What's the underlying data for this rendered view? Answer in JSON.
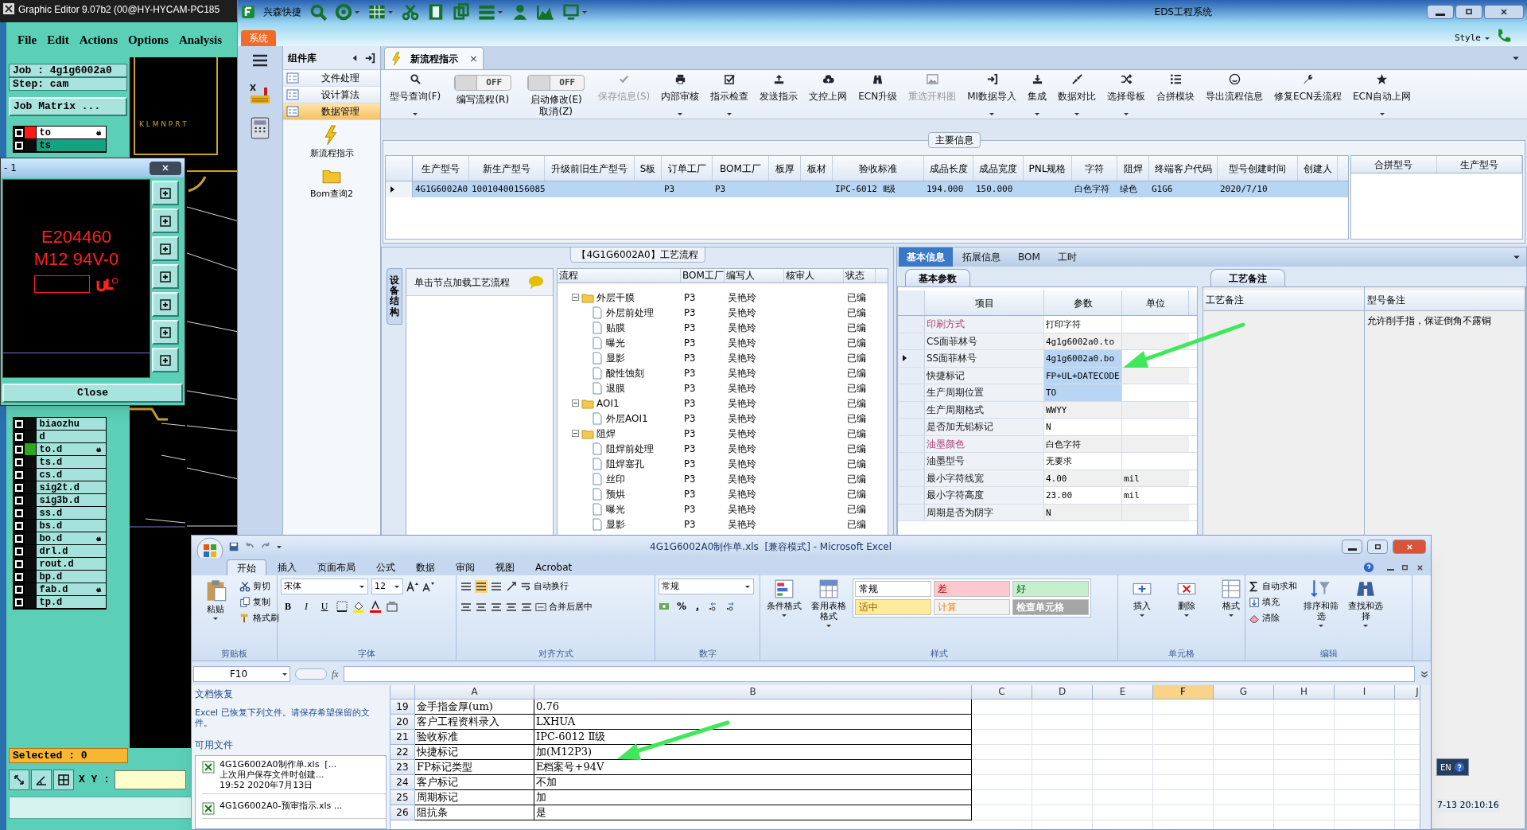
{
  "graphic_editor": {
    "title": "Graphic Editor 9.07b2 (00@HY-HYCAM-PC185",
    "menu": [
      "File",
      "Edit",
      "Actions",
      "Options",
      "Analysis"
    ],
    "job": "Job : 4g1g6002a0",
    "step": "Step: cam",
    "job_matrix": "Job Matrix ...",
    "layers_top": [
      {
        "name": "to",
        "color": "#ffffff",
        "checked": false,
        "work_layer": true,
        "displayed": false,
        "flag": true
      },
      {
        "name": "ts",
        "color": "#13a380",
        "checked": false,
        "work_layer": false,
        "displayed": false,
        "flag": false
      }
    ],
    "layers_bottom": [
      {
        "name": "biaozhu",
        "color": "#a6e2dc",
        "checked": false,
        "work_layer": false,
        "displayed": false,
        "flag": false
      },
      {
        "name": "d",
        "color": "#a6e2dc",
        "checked": false,
        "work_layer": false,
        "displayed": false,
        "flag": false
      },
      {
        "name": "to.d",
        "color": "#a6e2dc",
        "checked": false,
        "work_layer": false,
        "displayed": true,
        "flag": true
      },
      {
        "name": "ts.d",
        "color": "#a6e2dc",
        "checked": false,
        "work_layer": false,
        "displayed": false,
        "flag": false
      },
      {
        "name": "cs.d",
        "color": "#a6e2dc",
        "checked": false,
        "work_layer": false,
        "displayed": false,
        "flag": false
      },
      {
        "name": "sig2t.d",
        "color": "#a6e2dc",
        "checked": false,
        "work_layer": false,
        "displayed": false,
        "flag": false
      },
      {
        "name": "sig3b.d",
        "color": "#a6e2dc",
        "checked": false,
        "work_layer": false,
        "displayed": false,
        "flag": false
      },
      {
        "name": "ss.d",
        "color": "#a6e2dc",
        "checked": false,
        "work_layer": false,
        "displayed": false,
        "flag": false
      },
      {
        "name": "bs.d",
        "color": "#a6e2dc",
        "checked": false,
        "work_layer": false,
        "displayed": false,
        "flag": false
      },
      {
        "name": "bo.d",
        "color": "#a6e2dc",
        "checked": false,
        "work_layer": false,
        "displayed": false,
        "flag": true
      },
      {
        "name": "drl.d",
        "color": "#a6e2dc",
        "checked": false,
        "work_layer": false,
        "displayed": false,
        "flag": false
      },
      {
        "name": "rout.d",
        "color": "#a6e2dc",
        "checked": false,
        "work_layer": false,
        "displayed": false,
        "flag": false
      },
      {
        "name": "bp.d",
        "color": "#a6e2dc",
        "checked": false,
        "work_layer": false,
        "displayed": false,
        "flag": false
      },
      {
        "name": "fab.d",
        "color": "#a6e2dc",
        "checked": false,
        "work_layer": false,
        "displayed": false,
        "flag": true
      },
      {
        "name": "tp.d",
        "color": "#a6e2dc",
        "checked": false,
        "work_layer": false,
        "displayed": false,
        "flag": false
      }
    ],
    "canvas_label": "K L M N P R T",
    "selected": "Selected : 0",
    "xy_label": "X Y :"
  },
  "layer_dialog": {
    "title": "- 1",
    "lines": [
      "E204460",
      "M12 94V-0"
    ],
    "close": "Close"
  },
  "eds": {
    "title": "EDS工程系统",
    "quick_access": "兴森快捷",
    "ribbon_tabs": [
      {
        "label": "系统",
        "selected": true
      }
    ],
    "style_menu": "Style",
    "component_panel": {
      "title": "组件库",
      "items": [
        {
          "label": "文件处理",
          "selected": false
        },
        {
          "label": "设计算法",
          "selected": false
        },
        {
          "label": "数据管理",
          "selected": true
        }
      ],
      "shortcuts": [
        {
          "label": "新流程指示",
          "kind": "lightning"
        },
        {
          "label": "Bom查询2",
          "kind": "folder"
        }
      ]
    },
    "doc_tab": {
      "label": "新流程指示",
      "close": "×"
    },
    "toolbar": [
      {
        "kind": "button",
        "label": "型号查询(F)",
        "disabled": false,
        "dropdown": true
      },
      {
        "kind": "toggle",
        "label": "编写流程(R)",
        "state_text": "OFF",
        "on": false
      },
      {
        "kind": "toggle",
        "label": "启动修改(E)",
        "sub_label": "取消(Z)",
        "state_text": "OFF",
        "on": false
      },
      {
        "kind": "button",
        "label": "保存信息(S)",
        "disabled": true,
        "dropdown": false
      },
      {
        "kind": "button",
        "label": "内部审核",
        "disabled": false,
        "dropdown": true
      },
      {
        "kind": "button",
        "label": "指示检查",
        "disabled": false,
        "dropdown": true
      },
      {
        "kind": "button",
        "label": "发送指示",
        "disabled": false,
        "dropdown": false
      },
      {
        "kind": "button",
        "label": "文控上网",
        "disabled": false,
        "dropdown": false
      },
      {
        "kind": "button",
        "label": "ECN升级",
        "disabled": false,
        "dropdown": false
      },
      {
        "kind": "button",
        "label": "重选开料图",
        "disabled": true,
        "dropdown": false
      },
      {
        "kind": "button",
        "label": "MI数据导入",
        "disabled": false,
        "dropdown": true
      },
      {
        "kind": "button",
        "label": "集成",
        "disabled": false,
        "dropdown": true
      },
      {
        "kind": "button",
        "label": "数据对比",
        "disabled": false,
        "dropdown": true
      },
      {
        "kind": "button",
        "label": "选择母板",
        "disabled": false,
        "dropdown": true
      },
      {
        "kind": "button",
        "label": "合拼模块",
        "disabled": false,
        "dropdown": false
      },
      {
        "kind": "button",
        "label": "导出流程信息",
        "disabled": false,
        "dropdown": false
      },
      {
        "kind": "button",
        "label": "修复ECN丢流程",
        "disabled": false,
        "dropdown": false
      },
      {
        "kind": "button",
        "label": "ECN自动上网",
        "disabled": false,
        "dropdown": true
      }
    ],
    "main_info": {
      "title": "主要信息",
      "row_selected": true,
      "columns": [
        {
          "header": "生产型号",
          "value": "4G1G6002A0"
        },
        {
          "header": "新生产型号",
          "value": "10010400156085"
        },
        {
          "header": "升级前旧生产型号"
        },
        {
          "header": "S板"
        },
        {
          "header": "订单工厂",
          "value": "P3"
        },
        {
          "header": "BOM工厂",
          "value": "P3"
        },
        {
          "header": "板厚"
        },
        {
          "header": "板材"
        },
        {
          "header": "验收标准",
          "value": "IPC-6012 Ⅱ级"
        },
        {
          "header": "成品长度",
          "value": "194.000"
        },
        {
          "header": "成品宽度",
          "value": "150.000"
        },
        {
          "header": "PNL规格"
        },
        {
          "header": "字符",
          "value": "白色字符"
        },
        {
          "header": "阻焊",
          "value": "绿色"
        },
        {
          "header": "终端客户代码",
          "value": "G1G6"
        },
        {
          "header": "型号创建时间",
          "value": "2020/7/10"
        },
        {
          "header": "创建人"
        }
      ],
      "side_columns": [
        "合拼型号",
        "生产型号"
      ]
    },
    "process": {
      "title": "【4G1G6002A0】工艺流程",
      "side_tab": "设备结构",
      "hint": "单击节点加载工艺流程",
      "columns": [
        "流程",
        "BOM工厂",
        "编写人",
        "核审人",
        "状态"
      ],
      "tree": [
        {
          "name": "外层干膜",
          "kind": "folder",
          "expanded": true,
          "factory": "P3",
          "writer": "吴艳玲",
          "status": "已编",
          "children": [
            {
              "name": "外层前处理",
              "kind": "step",
              "factory": "P3",
              "writer": "吴艳玲",
              "status": "已编"
            },
            {
              "name": "贴膜",
              "kind": "step",
              "factory": "P3",
              "writer": "吴艳玲",
              "status": "已编"
            },
            {
              "name": "曝光",
              "kind": "step",
              "factory": "P3",
              "writer": "吴艳玲",
              "status": "已编"
            },
            {
              "name": "显影",
              "kind": "step",
              "factory": "P3",
              "writer": "吴艳玲",
              "status": "已编"
            },
            {
              "name": "酸性蚀刻",
              "kind": "step",
              "factory": "P3",
              "writer": "吴艳玲",
              "status": "已编"
            },
            {
              "name": "退膜",
              "kind": "step",
              "factory": "P3",
              "writer": "吴艳玲",
              "status": "已编"
            }
          ]
        },
        {
          "name": "AOI1",
          "kind": "folder",
          "expanded": true,
          "factory": "P3",
          "writer": "吴艳玲",
          "status": "已编",
          "children": [
            {
              "name": "外层AOI1",
              "kind": "step",
              "factory": "P3",
              "writer": "吴艳玲",
              "status": "已编"
            }
          ]
        },
        {
          "name": "阻焊",
          "kind": "folder",
          "expanded": true,
          "factory": "P3",
          "writer": "吴艳玲",
          "status": "已编",
          "children": [
            {
              "name": "阻焊前处理",
              "kind": "step",
              "factory": "P3",
              "writer": "吴艳玲",
              "status": "已编"
            },
            {
              "name": "阻焊塞孔",
              "kind": "step",
              "factory": "P3",
              "writer": "吴艳玲",
              "status": "已编"
            },
            {
              "name": "丝印",
              "kind": "step",
              "factory": "P3",
              "writer": "吴艳玲",
              "status": "已编"
            },
            {
              "name": "预烘",
              "kind": "step",
              "factory": "P3",
              "writer": "吴艳玲",
              "status": "已编"
            },
            {
              "name": "曝光",
              "kind": "step",
              "factory": "P3",
              "writer": "吴艳玲",
              "status": "已编"
            },
            {
              "name": "显影",
              "kind": "step",
              "factory": "P3",
              "writer": "吴艳玲",
              "status": "已编"
            }
          ]
        }
      ]
    },
    "detail_tabs": [
      {
        "label": "基本信息",
        "selected": true
      },
      {
        "label": "拓展信息",
        "selected": false
      },
      {
        "label": "BOM",
        "selected": false
      },
      {
        "label": "工时",
        "selected": false
      }
    ],
    "params": {
      "tab": "基本参数",
      "columns": [
        "项目",
        "参数",
        "单位"
      ],
      "rows": [
        {
          "item": "印刷方式",
          "value": "打印字符",
          "emphasis": true,
          "selected": false,
          "current": false
        },
        {
          "item": "CS面菲林号",
          "value": "4g1g6002a0.to",
          "emphasis": false,
          "selected": false,
          "current": false
        },
        {
          "item": "SS面菲林号",
          "value": "4g1g6002a0.bo",
          "emphasis": false,
          "selected": true,
          "current": true
        },
        {
          "item": "快捷标记",
          "value": "FP+UL+DATECODE",
          "emphasis": false,
          "selected": true,
          "current": false
        },
        {
          "item": "生产周期位置",
          "value": "TO",
          "emphasis": false,
          "selected": true,
          "current": false
        },
        {
          "item": "生产周期格式",
          "value": "WWYY",
          "emphasis": false,
          "selected": false,
          "current": false
        },
        {
          "item": "是否加无铅标记",
          "value": "N",
          "emphasis": false,
          "selected": false,
          "current": false
        },
        {
          "item": "油墨颜色",
          "value": "白色字符",
          "emphasis": true,
          "selected": false,
          "current": false
        },
        {
          "item": "油墨型号",
          "value": "无要求",
          "emphasis": false,
          "selected": false,
          "current": false
        },
        {
          "item": "最小字符线宽",
          "value": "4.00",
          "unit": "mil",
          "emphasis": false,
          "selected": false,
          "current": false
        },
        {
          "item": "最小字符高度",
          "value": "23.00",
          "unit": "mil",
          "emphasis": false,
          "selected": false,
          "current": false
        },
        {
          "item": "周期是否为阴字",
          "value": "N",
          "emphasis": false,
          "selected": false,
          "current": false
        }
      ]
    },
    "notes": {
      "tab": "工艺备注",
      "columns": [
        "工艺备注",
        "型号备注"
      ],
      "model_note": "允许削手指，保证倒角不露铜"
    },
    "language": "EN",
    "clock": "7-13 20:10:16"
  },
  "excel": {
    "title": "4G1G6002A0制作单.xls  [兼容模式] - Microsoft Excel",
    "tabs": [
      {
        "label": "开始",
        "selected": true
      },
      {
        "label": "插入",
        "selected": false
      },
      {
        "label": "页面布局",
        "selected": false
      },
      {
        "label": "公式",
        "selected": false
      },
      {
        "label": "数据",
        "selected": false
      },
      {
        "label": "审阅",
        "selected": false
      },
      {
        "label": "视图",
        "selected": false
      },
      {
        "label": "Acrobat",
        "selected": false
      }
    ],
    "clipboard": {
      "paste": "粘贴",
      "cut": "剪切",
      "copy": "复制",
      "format_painter": "格式刷"
    },
    "font": {
      "name": "宋体",
      "size": "12",
      "buttons": [
        "B",
        "I",
        "U"
      ]
    },
    "alignment": {
      "wrap": "自动换行",
      "merge": "合并后居中"
    },
    "number": {
      "format": "常规",
      "buttons": [
        "%",
        ","
      ]
    },
    "style_buttons": [
      "条件格式",
      "套用表格格式"
    ],
    "styles": [
      {
        "label": "常规",
        "color": "#ffffff"
      },
      {
        "label": "差",
        "color": "#ffc7ce"
      },
      {
        "label": "好",
        "color": "#c6efce"
      },
      {
        "label": "适中",
        "color": "#ffeb9c"
      },
      {
        "label": "计算",
        "color": "#f2f2f2"
      },
      {
        "label": "检查单元格",
        "color": "#a5a5a5"
      }
    ],
    "cell_buttons": [
      "插入",
      "删除",
      "格式"
    ],
    "editing": {
      "autosum": "自动求和",
      "fill": "填充",
      "clear": "清除",
      "sort": "排序和筛选",
      "find": "查找和选择"
    },
    "group_labels": [
      "剪贴板",
      "字体",
      "对齐方式",
      "数字",
      "样式",
      "单元格",
      "编辑"
    ],
    "name_box": "F10",
    "fx": "fx",
    "recovery": {
      "title": "文档恢复",
      "message": "Excel 已恢复下列文件。请保存希望保留的文件。",
      "available": "可用文件",
      "files": [
        {
          "name": "4G1G6002A0制作单.xls  [...",
          "detail": "上次用户保存文件时创建...",
          "time": "19:52 2020年7月13日"
        },
        {
          "name": "4G1G6002A0-预审指示.xls ..."
        }
      ]
    },
    "columns": [
      {
        "label": "A",
        "selected": false
      },
      {
        "label": "B",
        "selected": false
      },
      {
        "label": "C",
        "selected": false
      },
      {
        "label": "D",
        "selected": false
      },
      {
        "label": "E",
        "selected": false
      },
      {
        "label": "F",
        "selected": true
      },
      {
        "label": "G",
        "selected": false
      },
      {
        "label": "H",
        "selected": false
      },
      {
        "label": "I",
        "selected": false
      },
      {
        "label": "J",
        "selected": false
      }
    ],
    "rows": [
      {
        "num": "19",
        "a": "金手指金厚(um)",
        "b": "0.76"
      },
      {
        "num": "20",
        "a": "客户工程资料录入",
        "b": "LXHUA"
      },
      {
        "num": "21",
        "a": "验收标准",
        "b": "IPC-6012 Ⅱ级"
      },
      {
        "num": "22",
        "a": "快捷标记",
        "b": "加(M12P3)"
      },
      {
        "num": "23",
        "a": "FP标记类型",
        "b": "E档案号+94V"
      },
      {
        "num": "24",
        "a": "客户标记",
        "b": "不加"
      },
      {
        "num": "25",
        "a": "周期标记",
        "b": "加"
      },
      {
        "num": "26",
        "a": "阻抗条",
        "b": "是"
      }
    ]
  }
}
